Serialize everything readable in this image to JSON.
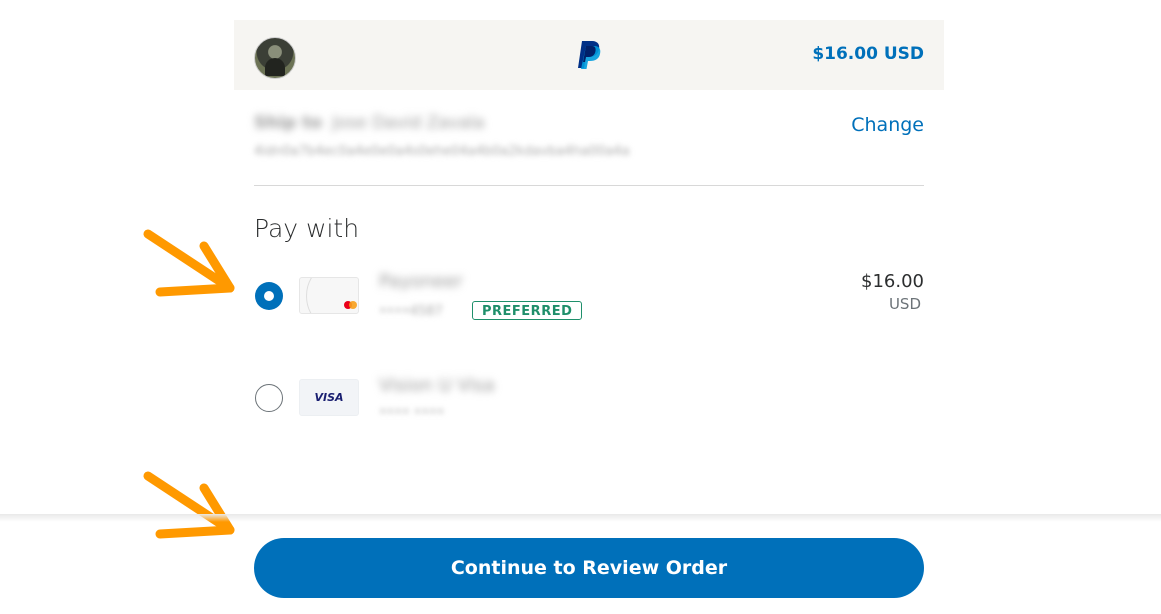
{
  "header": {
    "amount": "$16.00 USD",
    "logo_icon": "paypal-logo-icon",
    "brand_colors": {
      "primary": "#003087",
      "secondary": "#009cde"
    }
  },
  "shipping": {
    "label": "Ship to",
    "name": "Jose David Zavala",
    "address": "4idn0a7b4ec0a4e0e0a4s0ehe04a4b0a2kdavba4ha00a4a",
    "change_label": "Change"
  },
  "pay_with": {
    "title": "Pay with",
    "methods": [
      {
        "name": "Payoneer",
        "detail": "••••4587",
        "badge": "PREFERRED",
        "card_icon": "mastercard-icon",
        "amount": "$16.00",
        "currency": "USD",
        "selected": true
      },
      {
        "name": "Vision U Visa",
        "detail": "•••• ••••",
        "card_icon": "visa-icon",
        "card_label": "VISA",
        "selected": false
      }
    ]
  },
  "continue_button": {
    "label": "Continue to Review Order"
  },
  "colors": {
    "accent": "#0070ba",
    "header_bg": "#f6f5f2",
    "badge_green": "#1f8f6b",
    "annotation_arrow": "#ff9900"
  }
}
